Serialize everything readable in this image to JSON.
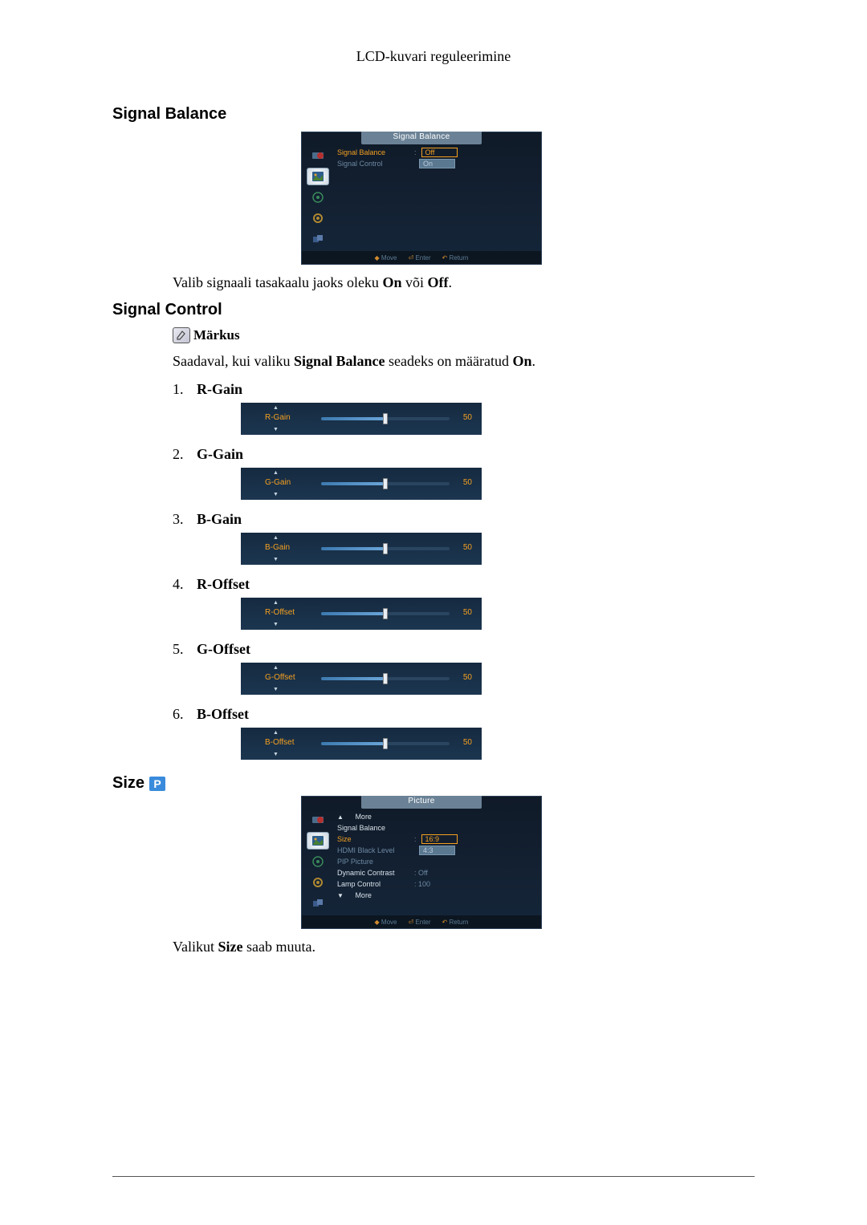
{
  "page_header": "LCD-kuvari reguleerimine",
  "sections": {
    "signal_balance": {
      "title": "Signal Balance",
      "osd_title": "Signal Balance",
      "menu_items": [
        {
          "label": "Signal Balance",
          "highlight": true
        },
        {
          "label": "Signal Control",
          "highlight": false
        }
      ],
      "options": {
        "off": "Off",
        "on": "On"
      },
      "footer": {
        "move": "Move",
        "enter": "Enter",
        "return": "Return"
      },
      "body_prefix": "Valib signaali tasakaalu jaoks oleku ",
      "body_on": "On",
      "body_mid": " või ",
      "body_off": "Off",
      "body_suffix": "."
    },
    "signal_control": {
      "title": "Signal Control",
      "note_label": "Märkus",
      "note_prefix": "Saadaval, kui valiku ",
      "note_bold": "Signal Balance",
      "note_mid": " seadeks on määratud ",
      "note_on": "On",
      "note_suffix": ".",
      "items": [
        {
          "num": "1.",
          "label": "R-Gain",
          "value": "50"
        },
        {
          "num": "2.",
          "label": "G-Gain",
          "value": "50"
        },
        {
          "num": "3.",
          "label": "B-Gain",
          "value": "50"
        },
        {
          "num": "4.",
          "label": "R-Offset",
          "value": "50"
        },
        {
          "num": "5.",
          "label": "G-Offset",
          "value": "50"
        },
        {
          "num": "6.",
          "label": "B-Offset",
          "value": "50"
        }
      ]
    },
    "size": {
      "title": "Size",
      "badge": "P",
      "osd_title": "Picture",
      "menu": {
        "more_up": "More",
        "items": [
          {
            "label": "Signal Balance",
            "val": ""
          },
          {
            "label": "Size",
            "val": "16:9",
            "selected": true
          },
          {
            "label": "HDMI Black Level",
            "val": "4:3",
            "hl": true
          },
          {
            "label": "PIP Picture",
            "val": ""
          },
          {
            "label": "Dynamic Contrast",
            "val": ": Off"
          },
          {
            "label": "Lamp Control",
            "val": ": 100"
          }
        ],
        "more_down": "More"
      },
      "footer": {
        "move": "Move",
        "enter": "Enter",
        "return": "Return"
      },
      "body_prefix": "Valikut ",
      "body_bold": "Size",
      "body_suffix": " saab muuta."
    }
  }
}
